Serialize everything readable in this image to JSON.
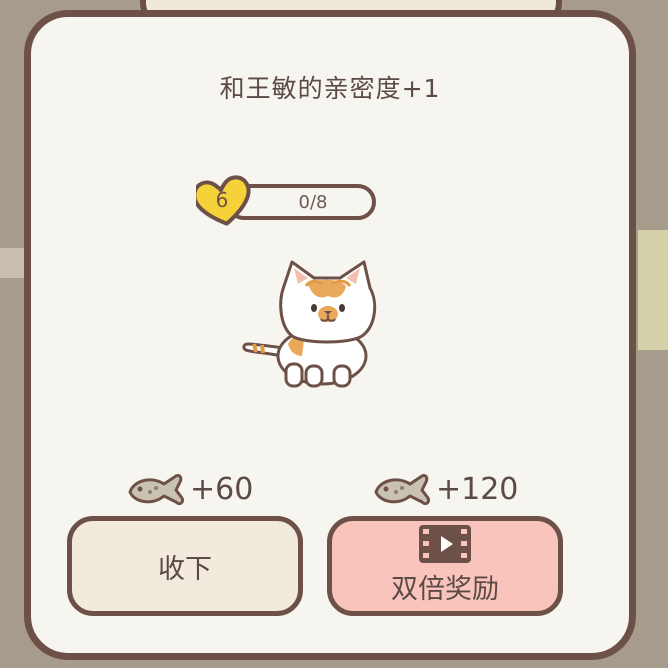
{
  "dialog": {
    "title": "和王敏的亲密度+1"
  },
  "affinity": {
    "level": "6",
    "progress_text": "0/8",
    "progress": 0.0
  },
  "rewards": [
    {
      "icon": "fish-icon",
      "amount": "+60"
    },
    {
      "icon": "fish-icon",
      "amount": "+120"
    }
  ],
  "buttons": {
    "collect_label": "收下",
    "double_label": "双倍奖励",
    "double_icon": "video-play-icon"
  },
  "colors": {
    "panel_bg": "#f7f5ef",
    "border": "#6d5148",
    "heart": "#f5d23a",
    "collect_button": "#f2ebdd",
    "double_button": "#f9c4bc"
  }
}
